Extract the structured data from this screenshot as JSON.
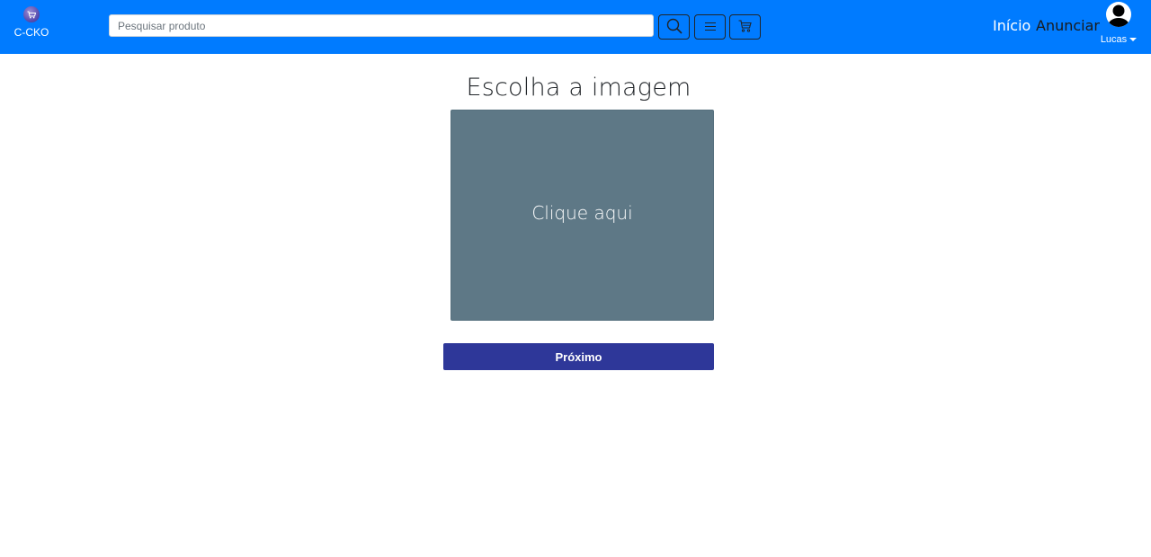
{
  "navbar": {
    "brand": {
      "name": "C-CKO",
      "logo_icon": "cart-logo-icon"
    },
    "search": {
      "placeholder": "Pesquisar produto",
      "value": ""
    },
    "buttons": [
      {
        "icon": "search-icon"
      },
      {
        "icon": "menu-icon"
      },
      {
        "icon": "cart-icon"
      }
    ],
    "links": {
      "inicio": "Início",
      "anunciar": "Anunciar"
    },
    "user": {
      "name": "Lucas",
      "icon": "user-avatar-icon"
    },
    "colors": {
      "background": "#007bff",
      "active_link": "#ffffff",
      "inactive_link": "#1a1a1a"
    }
  },
  "main": {
    "title": "Escolha a imagem",
    "image_picker": {
      "label": "Clique aqui",
      "color": "#5e7886"
    },
    "next_button": {
      "label": "Próximo",
      "color": "#2e3799"
    }
  }
}
